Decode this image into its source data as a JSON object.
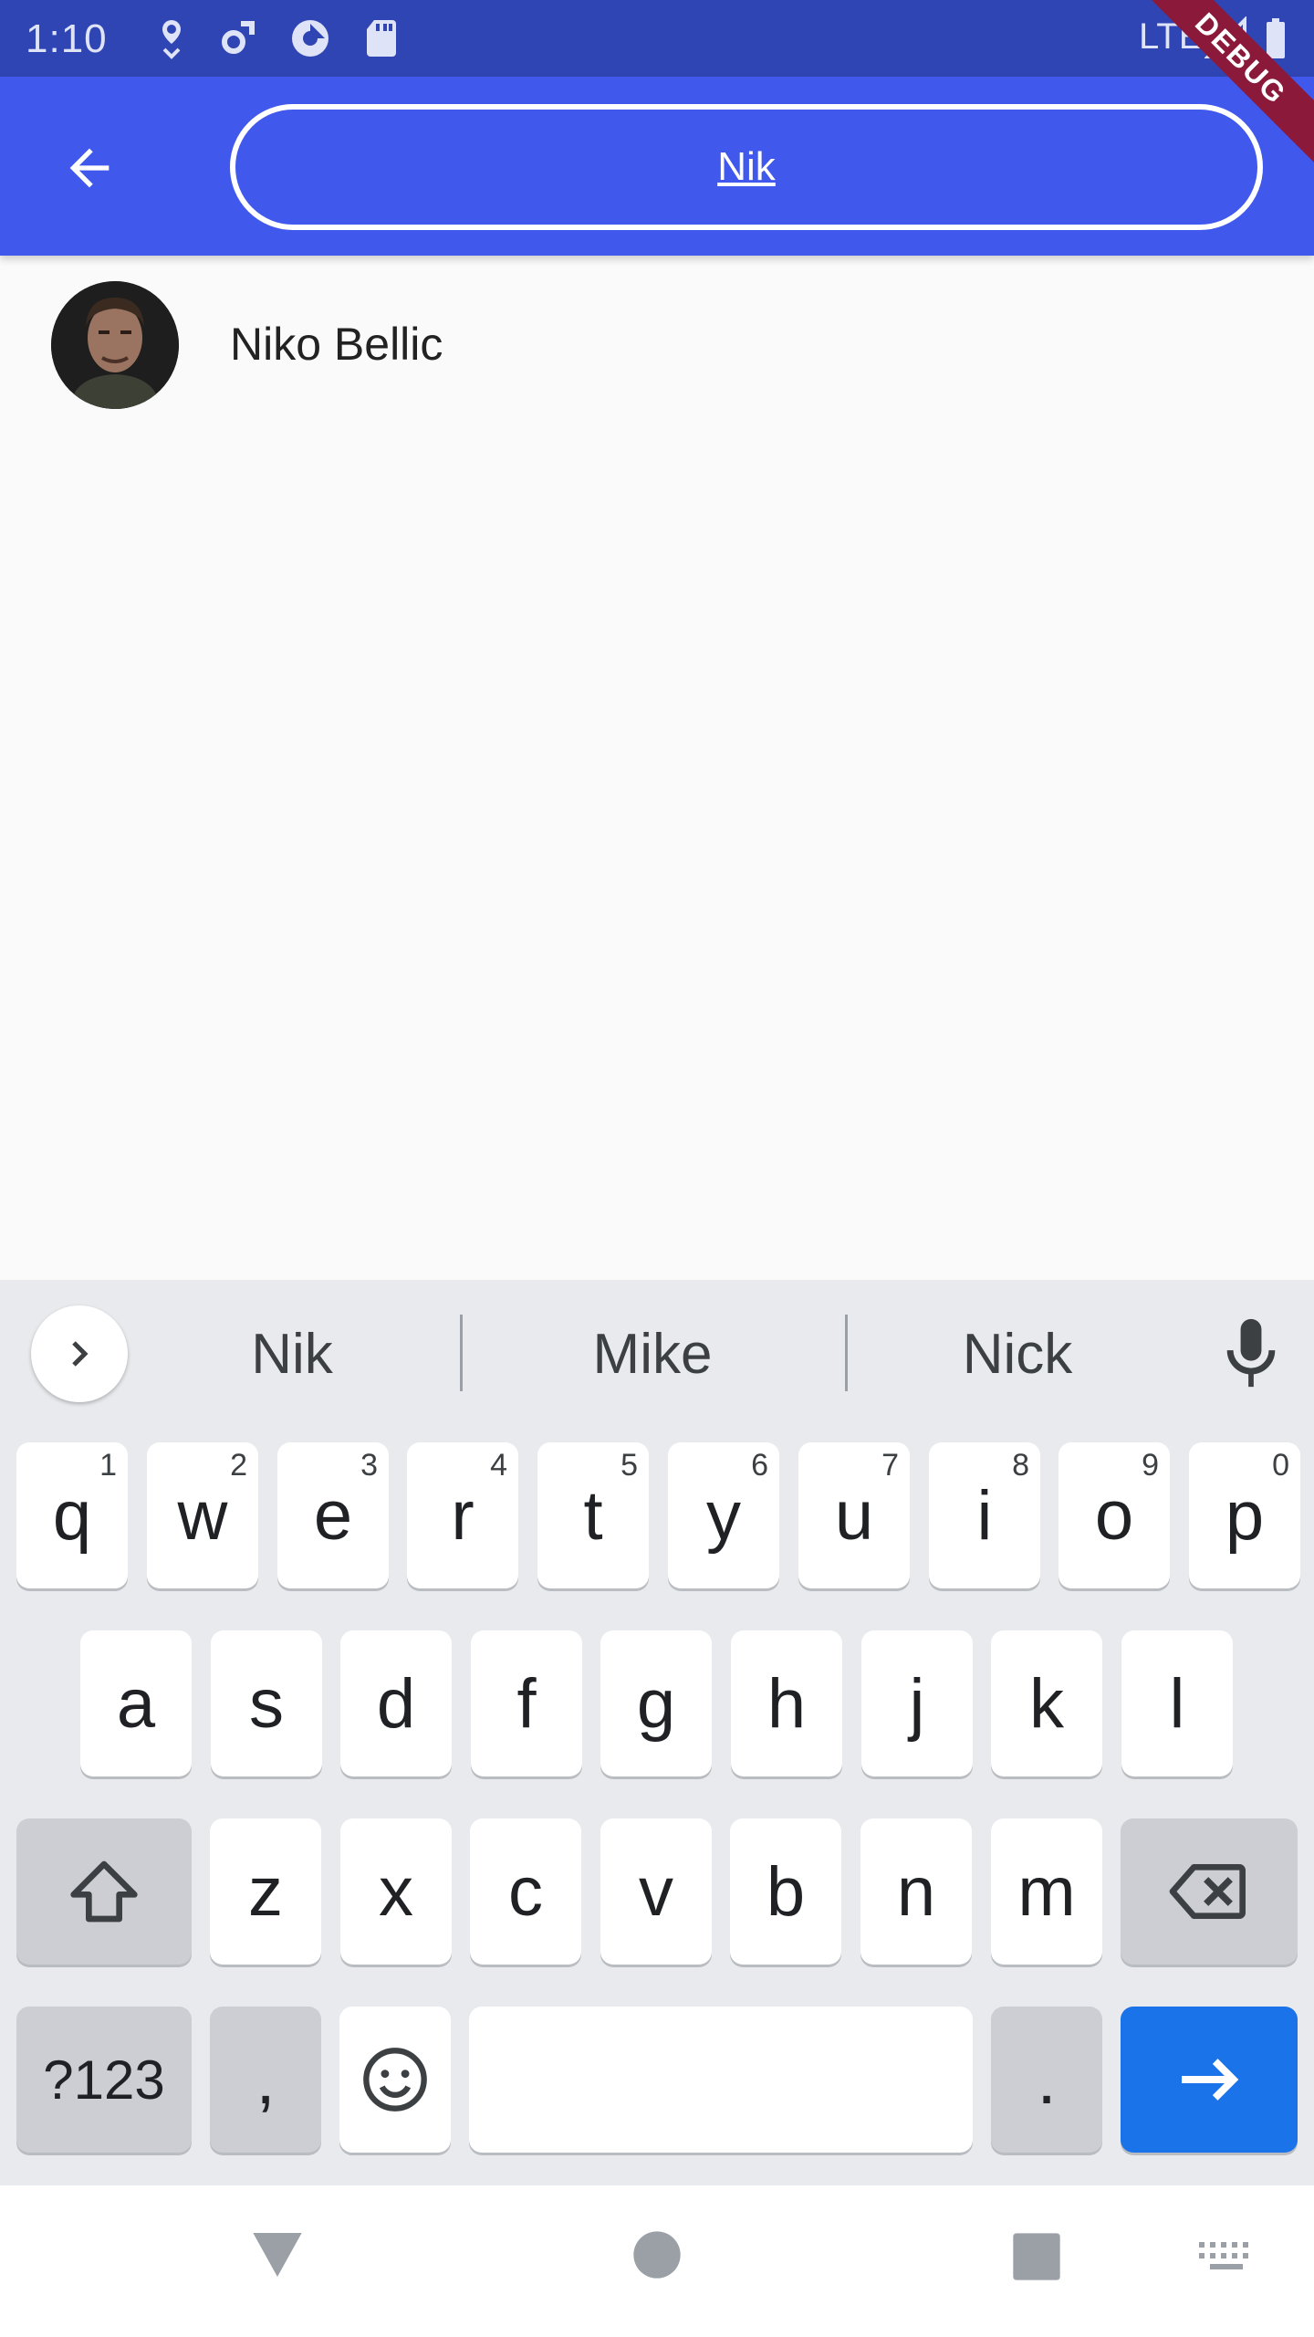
{
  "status_bar": {
    "time": "1:10",
    "network": "LTE",
    "icons": [
      "location-heart-icon",
      "settings-sync-icon",
      "data-saver-icon",
      "sd-card-icon",
      "signal-icon",
      "battery-icon"
    ]
  },
  "debug_banner": "DEBUG",
  "app_bar": {
    "back_icon": "arrow-left-icon",
    "search_value": "Nik",
    "color": "#4059ec"
  },
  "results": [
    {
      "name": "Niko Bellic",
      "avatar_icon": "avatar-portrait"
    }
  ],
  "keyboard": {
    "suggestions": [
      "Nik",
      "Mike",
      "Nick"
    ],
    "rows": [
      [
        {
          "label": "q",
          "hint": "1"
        },
        {
          "label": "w",
          "hint": "2"
        },
        {
          "label": "e",
          "hint": "3"
        },
        {
          "label": "r",
          "hint": "4"
        },
        {
          "label": "t",
          "hint": "5"
        },
        {
          "label": "y",
          "hint": "6"
        },
        {
          "label": "u",
          "hint": "7"
        },
        {
          "label": "i",
          "hint": "8"
        },
        {
          "label": "o",
          "hint": "9"
        },
        {
          "label": "p",
          "hint": "0"
        }
      ],
      [
        {
          "label": "a"
        },
        {
          "label": "s"
        },
        {
          "label": "d"
        },
        {
          "label": "f"
        },
        {
          "label": "g"
        },
        {
          "label": "h"
        },
        {
          "label": "j"
        },
        {
          "label": "k"
        },
        {
          "label": "l"
        }
      ],
      [
        {
          "label": "z"
        },
        {
          "label": "x"
        },
        {
          "label": "c"
        },
        {
          "label": "v"
        },
        {
          "label": "b"
        },
        {
          "label": "n"
        },
        {
          "label": "m"
        }
      ]
    ],
    "symbols_label": "?123",
    "comma_label": ",",
    "period_label": ".",
    "accent_color": "#1a73e8"
  },
  "nav_bar": {
    "icons": [
      "back-triangle-icon",
      "home-circle-icon",
      "recents-square-icon",
      "keyboard-switch-icon"
    ]
  }
}
